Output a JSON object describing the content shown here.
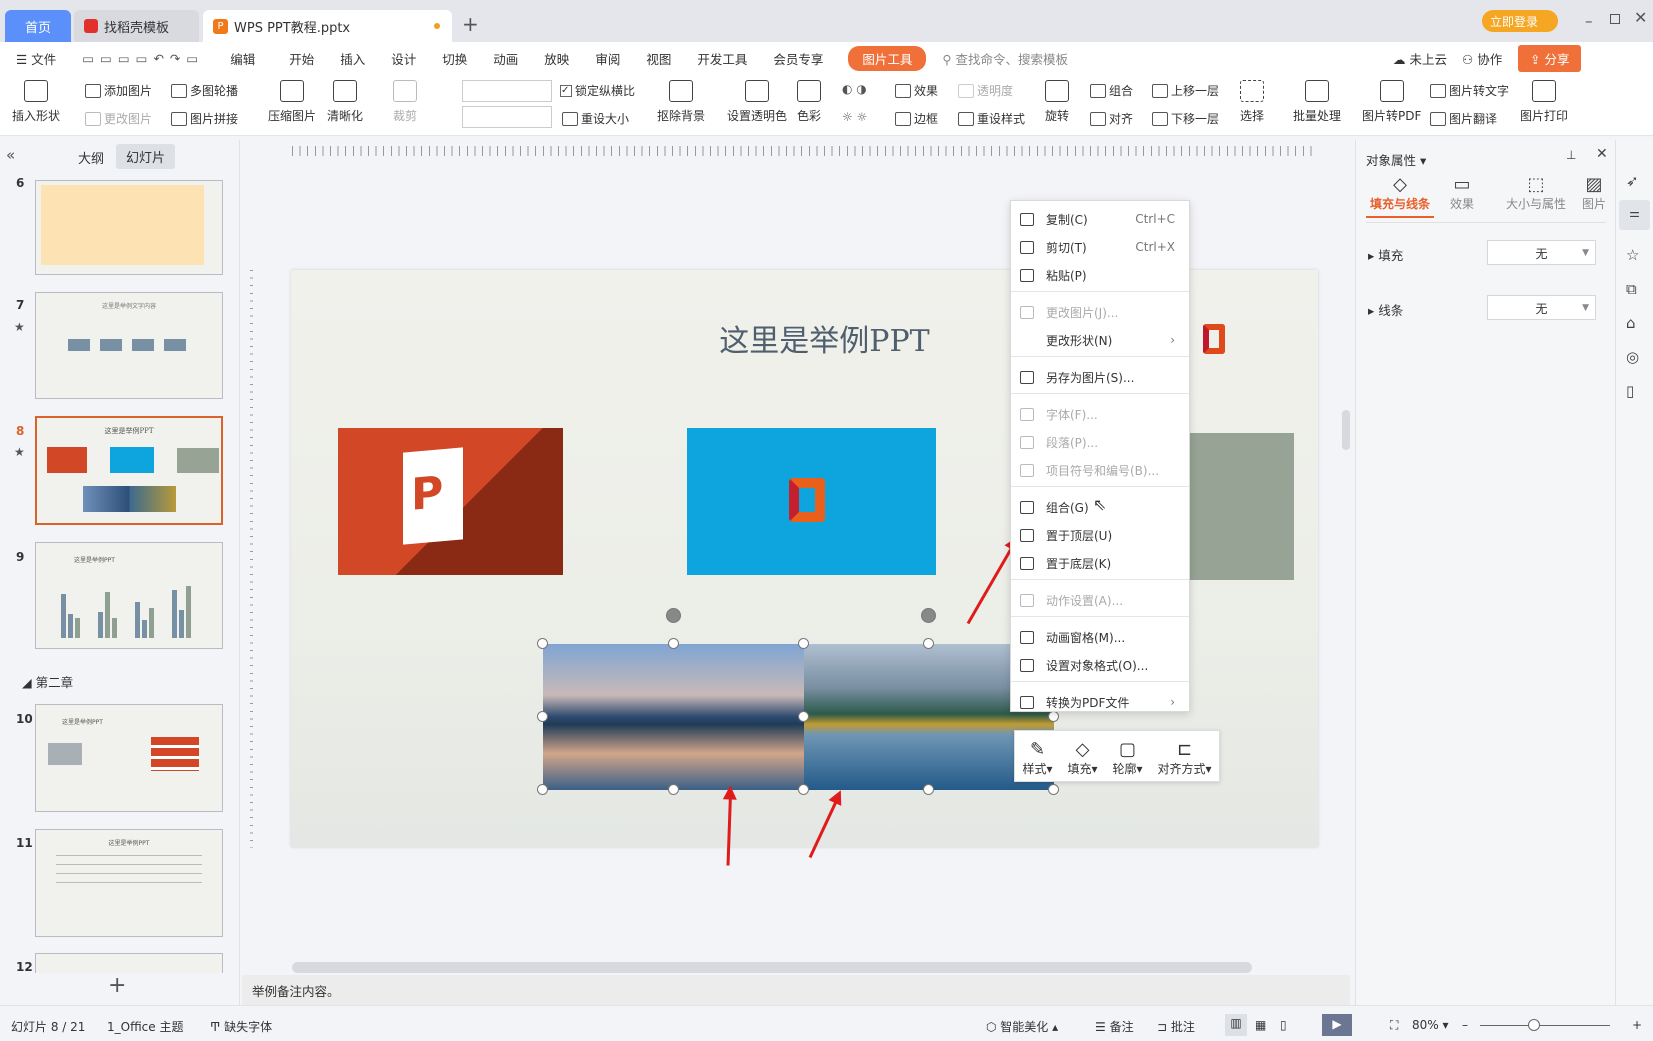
{
  "tabs": {
    "home": "首页",
    "templates": "找稻壳模板",
    "doc": "WPS PPT教程.pptx",
    "new": "+",
    "login": "立即登录"
  },
  "menu": {
    "file": "文件",
    "edit": "编辑",
    "items": [
      "开始",
      "插入",
      "设计",
      "切换",
      "动画",
      "放映",
      "审阅",
      "视图",
      "开发工具",
      "会员专享"
    ],
    "pic_tools": "图片工具",
    "search": "查找命令、搜索模板",
    "cloud": "未上云",
    "collab": "协作",
    "share": "分享"
  },
  "ribbon": {
    "insert_shape": "插入形状",
    "add_pic": "添加图片",
    "change_pic": "更改图片",
    "carousel": "多图轮播",
    "stitch": "图片拼接",
    "compress": "压缩图片",
    "sharpen": "清晰化",
    "crop": "裁剪",
    "lock_ratio": "锁定纵横比",
    "reset_size": "重设大小",
    "remove_bg": "抠除背景",
    "set_transparent": "设置透明色",
    "color": "色彩",
    "effect": "效果",
    "transparency": "透明度",
    "border": "边框",
    "reset_style": "重设样式",
    "rotate": "旋转",
    "group": "组合",
    "align": "对齐",
    "bring_forward": "上移一层",
    "send_backward": "下移一层",
    "select": "选择",
    "batch": "批量处理",
    "to_pdf": "图片转PDF",
    "to_text": "图片转文字",
    "translate": "图片翻译",
    "print": "图片打印"
  },
  "left": {
    "outline": "大纲",
    "slides": "幻灯片",
    "chapter": "第二章",
    "nums": [
      "6",
      "7",
      "8",
      "9",
      "10",
      "11",
      "12"
    ],
    "t7": "这里是举例文字内容",
    "t8": "这里是举例PPT",
    "t9": "这里是举例PPT",
    "t10": "这里是举例PPT",
    "t11": "这里是举例PPT",
    "add": "+"
  },
  "slide": {
    "title": "这里是举例PPT"
  },
  "context_menu": [
    {
      "label": "复制(C)",
      "shortcut": "Ctrl+C",
      "disabled": false
    },
    {
      "label": "剪切(T)",
      "shortcut": "Ctrl+X",
      "disabled": false
    },
    {
      "label": "粘贴(P)",
      "disabled": false
    },
    {
      "label": "更改图片(J)...",
      "disabled": true
    },
    {
      "label": "更改形状(N)",
      "disabled": false
    },
    {
      "label": "另存为图片(S)...",
      "disabled": false
    },
    {
      "label": "字体(F)...",
      "disabled": true
    },
    {
      "label": "段落(P)...",
      "disabled": true
    },
    {
      "label": "项目符号和编号(B)...",
      "disabled": true
    },
    {
      "label": "组合(G)",
      "disabled": false
    },
    {
      "label": "置于顶层(U)",
      "disabled": false
    },
    {
      "label": "置于底层(K)",
      "disabled": false
    },
    {
      "label": "动作设置(A)...",
      "disabled": true
    },
    {
      "label": "动画窗格(M)...",
      "disabled": false
    },
    {
      "label": "设置对象格式(O)...",
      "disabled": false
    },
    {
      "label": "转换为PDF文件",
      "disabled": false
    }
  ],
  "mini_toolbar": [
    "样式",
    "填充",
    "轮廓",
    "对齐方式"
  ],
  "right": {
    "title": "对象属性",
    "tabs": [
      "填充与线条",
      "效果",
      "大小与属性",
      "图片"
    ],
    "fill": "填充",
    "line": "线条",
    "fill_val": "无",
    "line_val": "无"
  },
  "notes": "举例备注内容。",
  "status": {
    "slide": "幻灯片 8 / 21",
    "theme": "1_Office 主题",
    "font": "缺失字体",
    "beautify": "智能美化",
    "notes": "备注",
    "comment": "批注",
    "zoom": "80%"
  },
  "colors": {
    "accent": "#f0703a",
    "ppt_red": "#d24726",
    "office_blue": "#0ea5df",
    "tab_blue": "#5b8ff9"
  }
}
